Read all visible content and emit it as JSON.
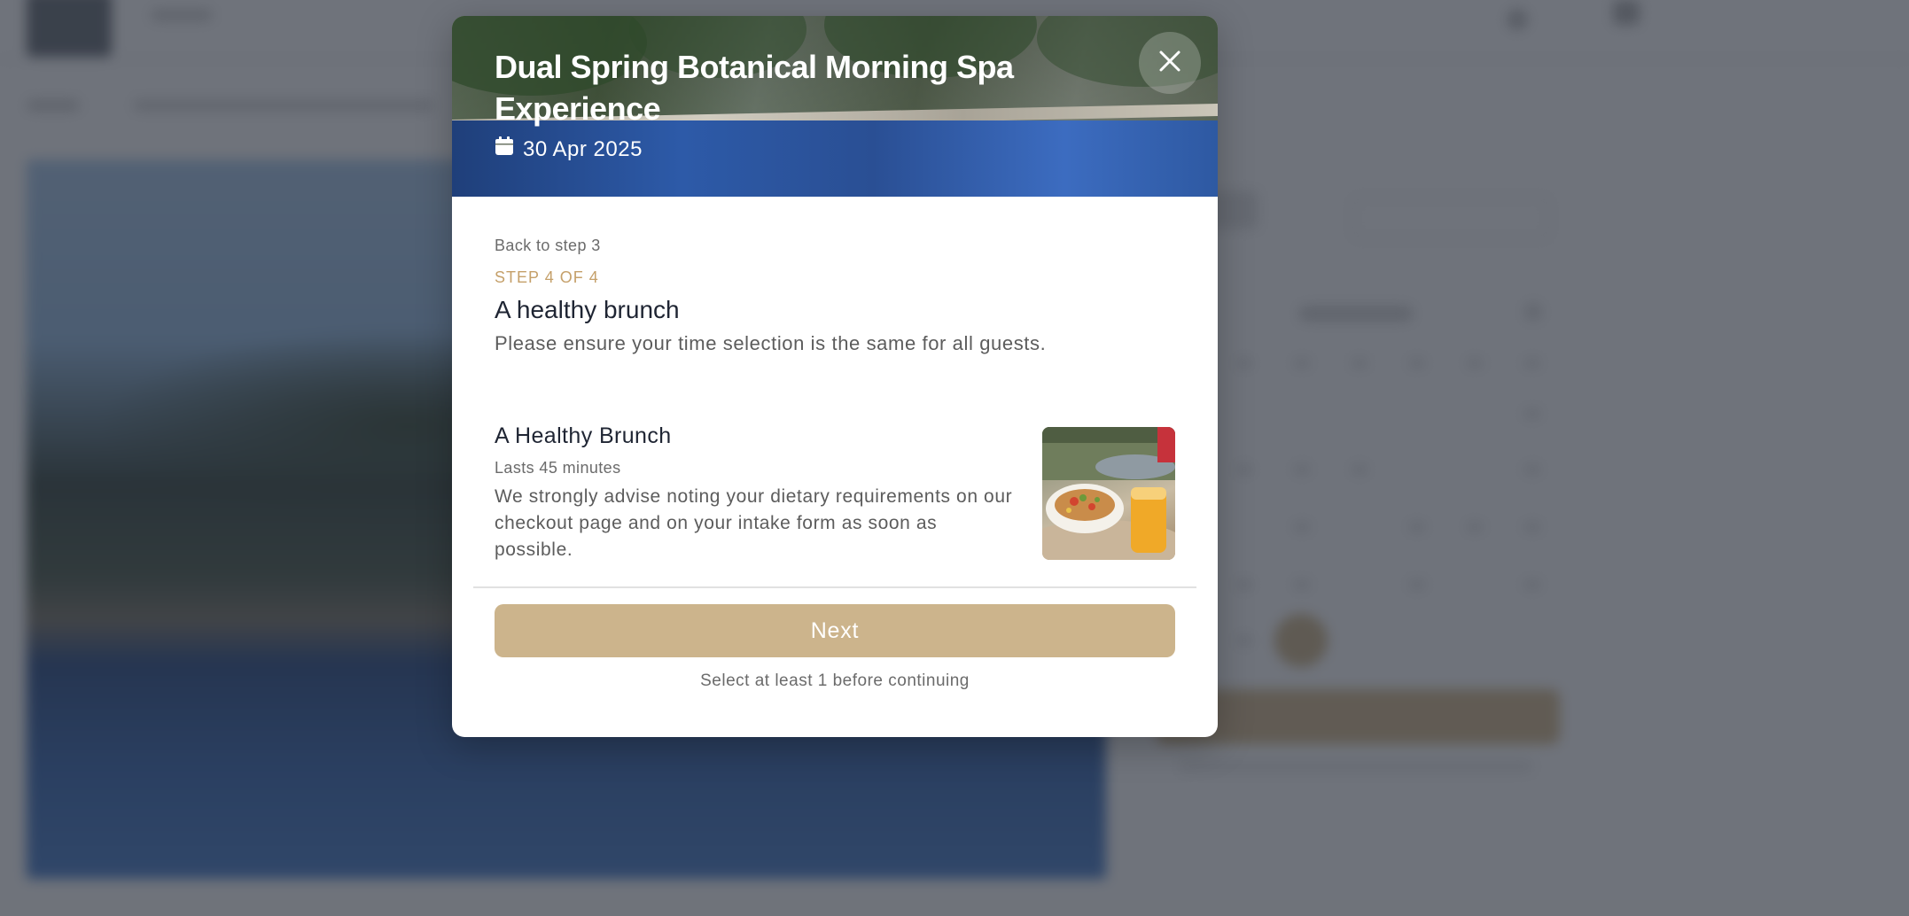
{
  "modal": {
    "title": "Dual Spring Botanical Morning Spa Experience",
    "date": "30 Apr 2025",
    "back_label": "Back to step 3",
    "step_label": "STEP 4 OF 4",
    "step_title": "A healthy brunch",
    "step_description": "Please ensure your time selection is the same for all guests.",
    "option": {
      "name": "A Healthy Brunch",
      "duration": "Lasts 45 minutes",
      "description": "We strongly advise noting your dietary requirements on our checkout page and on your intake form as soon as possible."
    },
    "next_label": "Next",
    "hint": "Select at least 1 before continuing"
  },
  "colors": {
    "accent": "#c5a06a",
    "button": "#ccb48c",
    "overlay": "#2a303c",
    "text_dark": "#1f2533",
    "text_muted": "#5c5c5c"
  },
  "icons": {
    "date": "calendar-icon",
    "close": "close-icon"
  }
}
